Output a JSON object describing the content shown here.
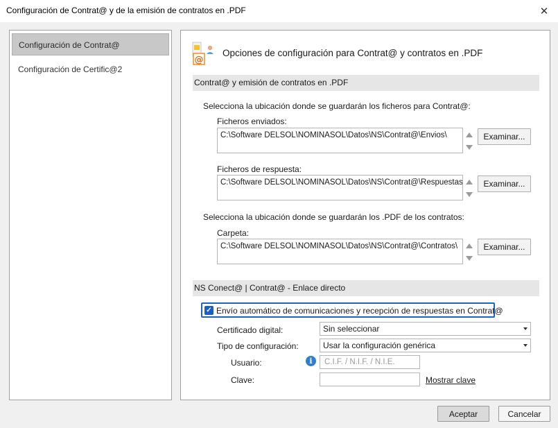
{
  "window": {
    "title": "Configuración de Contrat@ y de la emisión de contratos en .PDF",
    "close_glyph": "✕"
  },
  "sidebar": {
    "items": [
      {
        "label": "Configuración de Contrat@",
        "selected": true
      },
      {
        "label": "Configuración de Certific@2",
        "selected": false
      }
    ]
  },
  "main": {
    "header_title": "Opciones de configuración para Contrat@ y contratos en .PDF",
    "header_icon": "contract-config-icon",
    "section1": {
      "title": "Contrat@ y emisión de contratos en .PDF",
      "instruction1": "Selecciona la ubicación donde se guardarán los ficheros para Contrat@:",
      "sent_label": "Ficheros enviados:",
      "sent_path": "C:\\Software DELSOL\\NOMINASOL\\Datos\\NS\\Contrat@\\Envios\\",
      "response_label": "Ficheros de respuesta:",
      "response_path": "C:\\Software DELSOL\\NOMINASOL\\Datos\\NS\\Contrat@\\Respuestas\\",
      "instruction2": "Selecciona la ubicación donde se guardarán los .PDF de los contratos:",
      "folder_label": "Carpeta:",
      "folder_path": "C:\\Software DELSOL\\NOMINASOL\\Datos\\NS\\Contrat@\\Contratos\\",
      "browse_label": "Examinar..."
    },
    "section2": {
      "title": "NS Conect@ | Contrat@ - Enlace directo",
      "auto_send_label": "Envío automático de comunicaciones y recepción de respuestas en Contrat@",
      "auto_send_checked": true,
      "certificate_label": "Certificado digital:",
      "certificate_value": "Sin seleccionar",
      "config_type_label": "Tipo de configuración:",
      "config_type_value": "Usar la configuración genérica",
      "user_label": "Usuario:",
      "user_placeholder": "C.I.F. / N.I.F. / N.I.E.",
      "password_label": "Clave:",
      "password_value": "",
      "show_password_label": "Mostrar clave"
    }
  },
  "footer": {
    "accept_label": "Aceptar",
    "cancel_label": "Cancelar"
  },
  "colors": {
    "accent": "#1a5fc4",
    "info": "#2d7fd3",
    "section_bg": "#e6e6e6",
    "selected_bg": "#c8c8c8"
  }
}
